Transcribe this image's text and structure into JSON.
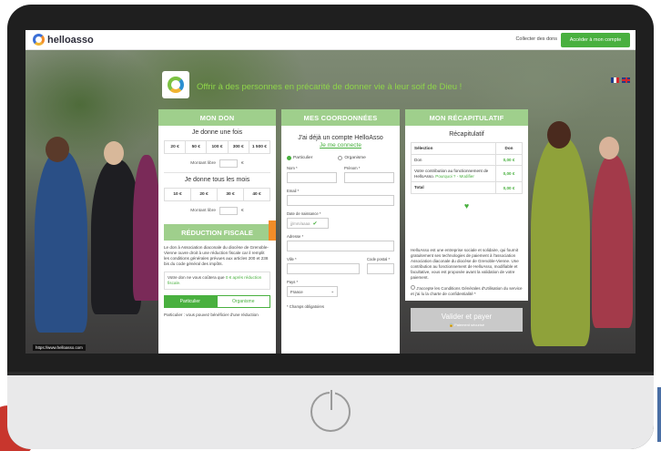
{
  "header": {
    "brand": "helloasso",
    "link_donations": "Collecter des dons",
    "cta": "Accéder à mon compte"
  },
  "hero": {
    "tagline": "Offrir à des personnes en précarité de donner vie à leur soif de Dieu !"
  },
  "don": {
    "heading": "MON DON",
    "once_title": "Je donne une fois",
    "once_amounts": [
      "20 €",
      "50 €",
      "100 €",
      "300 €",
      "1 500 €"
    ],
    "free_label": "Montant libre",
    "currency": "€",
    "monthly_title": "Je donne tous les mois",
    "monthly_amounts": [
      "10 €",
      "20 €",
      "30 €",
      "40 €"
    ],
    "fiscal_heading": "RÉDUCTION FISCALE",
    "fiscal_text": "Le don à Association diaconale du diocèse de Grenoble-Vienne ouvre droit à une réduction fiscale car il remplit les conditions générales prévues aux articles 200 et 238 bis du code général des impôts.",
    "cost_text": "Votre don ne vous coûtera que",
    "cost_amount": "0 € après réduction fiscale.",
    "toggle_particulier": "Particulier",
    "toggle_organisme": "Organisme",
    "particulier_text": "Particulier : vous pouvez bénéficier d'une réduction"
  },
  "coords": {
    "heading": "MES COORDONNÉES",
    "account_title": "J'ai déjà un compte HelloAsso",
    "account_link": "Je me connecte",
    "radio_particulier": "Particulier",
    "radio_organisme": "Organisme",
    "nom": "Nom *",
    "prenom": "Prénom *",
    "email": "Email *",
    "dob": "Date de naissance *",
    "dob_placeholder": "jj/mm/aaaa",
    "adresse": "Adresse *",
    "ville": "Ville *",
    "cp": "Code postal *",
    "pays": "Pays *",
    "pays_value": "France",
    "required": "* Champs obligatoires"
  },
  "recap": {
    "heading": "MON RÉCAPITULATIF",
    "title": "Récapitulatif",
    "col_selection": "Sélection",
    "col_don": "Don",
    "row_don": "Don",
    "row_don_val": "0,00 €",
    "row_contrib": "Votre contribution au fonctionnement de HelloAsso.",
    "row_contrib_why": "Pourquoi ? - Modifier",
    "row_contrib_val": "0,00 €",
    "row_total": "Total",
    "row_total_val": "0,00 €",
    "note": "HelloAsso est une entreprise sociale et solidaire, qui fournit gratuitement ses technologies de paiement à l'association Association diaconale du diocèse de Grenoble-Vienne. Une contribution au fonctionnement de HelloAsso, modifiable et facultative, vous est proposée avant la validation de votre paiement.",
    "accept": "J'accepte les Conditions Générales d'Utilisation du service et j'ai lu la charte de confidentialité *",
    "pay_button": "Valider et payer",
    "pay_sub": "Paiement sécurisé"
  },
  "status_url": "https://www.helloasso.com"
}
